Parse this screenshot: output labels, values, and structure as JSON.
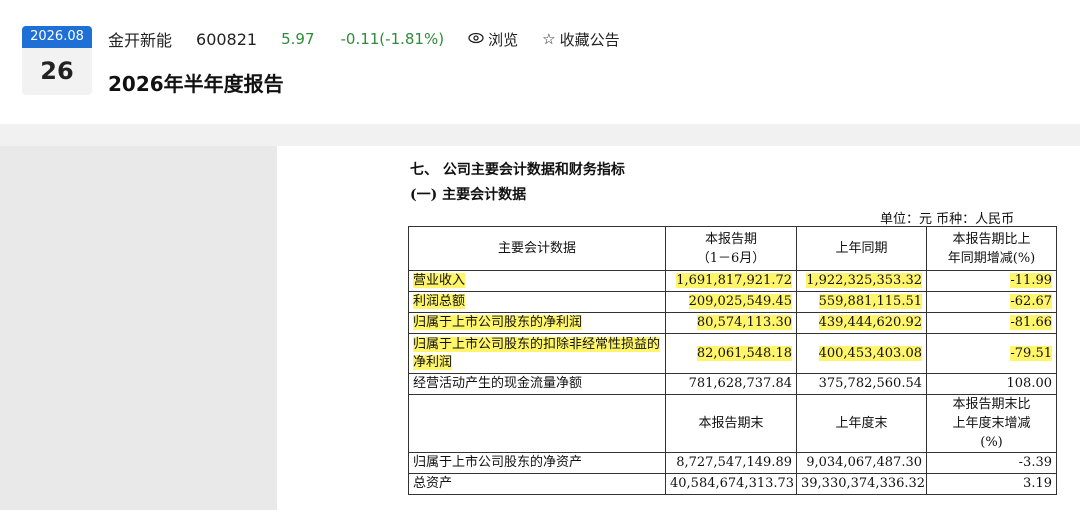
{
  "header": {
    "date_month": "2026.08",
    "date_day": "26",
    "stock_name": "金开新能",
    "stock_code": "600821",
    "price": "5.97",
    "change": "-0.11(-1.81%)",
    "browse_label": "浏览",
    "favorite_label": "收藏公告",
    "report_title": "2026年半年度报告"
  },
  "colors": {
    "date_badge": "#1e6fd6",
    "price_text": "#2e8b3a",
    "highlight": "#fff56a"
  },
  "doc": {
    "section_title": "七、 公司主要会计数据和财务指标",
    "sub_title": "(一) 主要会计数据",
    "unit": "单位：元 币种：人民币",
    "table1_headers": [
      "主要会计数据",
      "本报告期\n（1－6月）",
      "上年同期",
      "本报告期比上\n年同期增减(%)"
    ],
    "table1_rows": [
      {
        "name": "营业收入",
        "cur": "1,691,817,921.72",
        "prev": "1,922,325,353.32",
        "chg": "-11.99",
        "highlight": true
      },
      {
        "name": "利润总额",
        "cur": "209,025,549.45",
        "prev": "559,881,115.51",
        "chg": "-62.67",
        "highlight": true
      },
      {
        "name": "归属于上市公司股东的净利润",
        "cur": "80,574,113.30",
        "prev": "439,444,620.92",
        "chg": "-81.66",
        "highlight": true
      },
      {
        "name": "归属于上市公司股东的扣除非经常性损益的净利润",
        "cur": "82,061,548.18",
        "prev": "400,453,403.08",
        "chg": "-79.51",
        "highlight": true
      },
      {
        "name": "经营活动产生的现金流量净额",
        "cur": "781,628,737.84",
        "prev": "375,782,560.54",
        "chg": "108.00",
        "highlight": false
      }
    ],
    "table2_headers": [
      "",
      "本报告期末",
      "上年度末",
      "本报告期末比\n上年度末增减\n(%)"
    ],
    "table2_rows": [
      {
        "name": "归属于上市公司股东的净资产",
        "cur": "8,727,547,149.89",
        "prev": "9,034,067,487.30",
        "chg": "-3.39"
      },
      {
        "name": "总资产",
        "cur": "40,584,674,313.73",
        "prev": "39,330,374,336.32",
        "chg": "3.19"
      }
    ]
  }
}
